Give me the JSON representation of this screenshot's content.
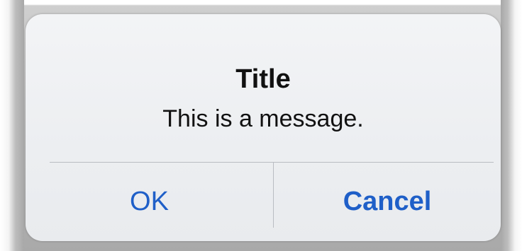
{
  "alert": {
    "title": "Title",
    "message": "This is a message.",
    "buttons": [
      {
        "label": "OK"
      },
      {
        "label": "Cancel"
      }
    ]
  },
  "colors": {
    "button_text": "#1f5fc8",
    "alert_background": "#eceef1",
    "divider": "#b9bcc2"
  }
}
